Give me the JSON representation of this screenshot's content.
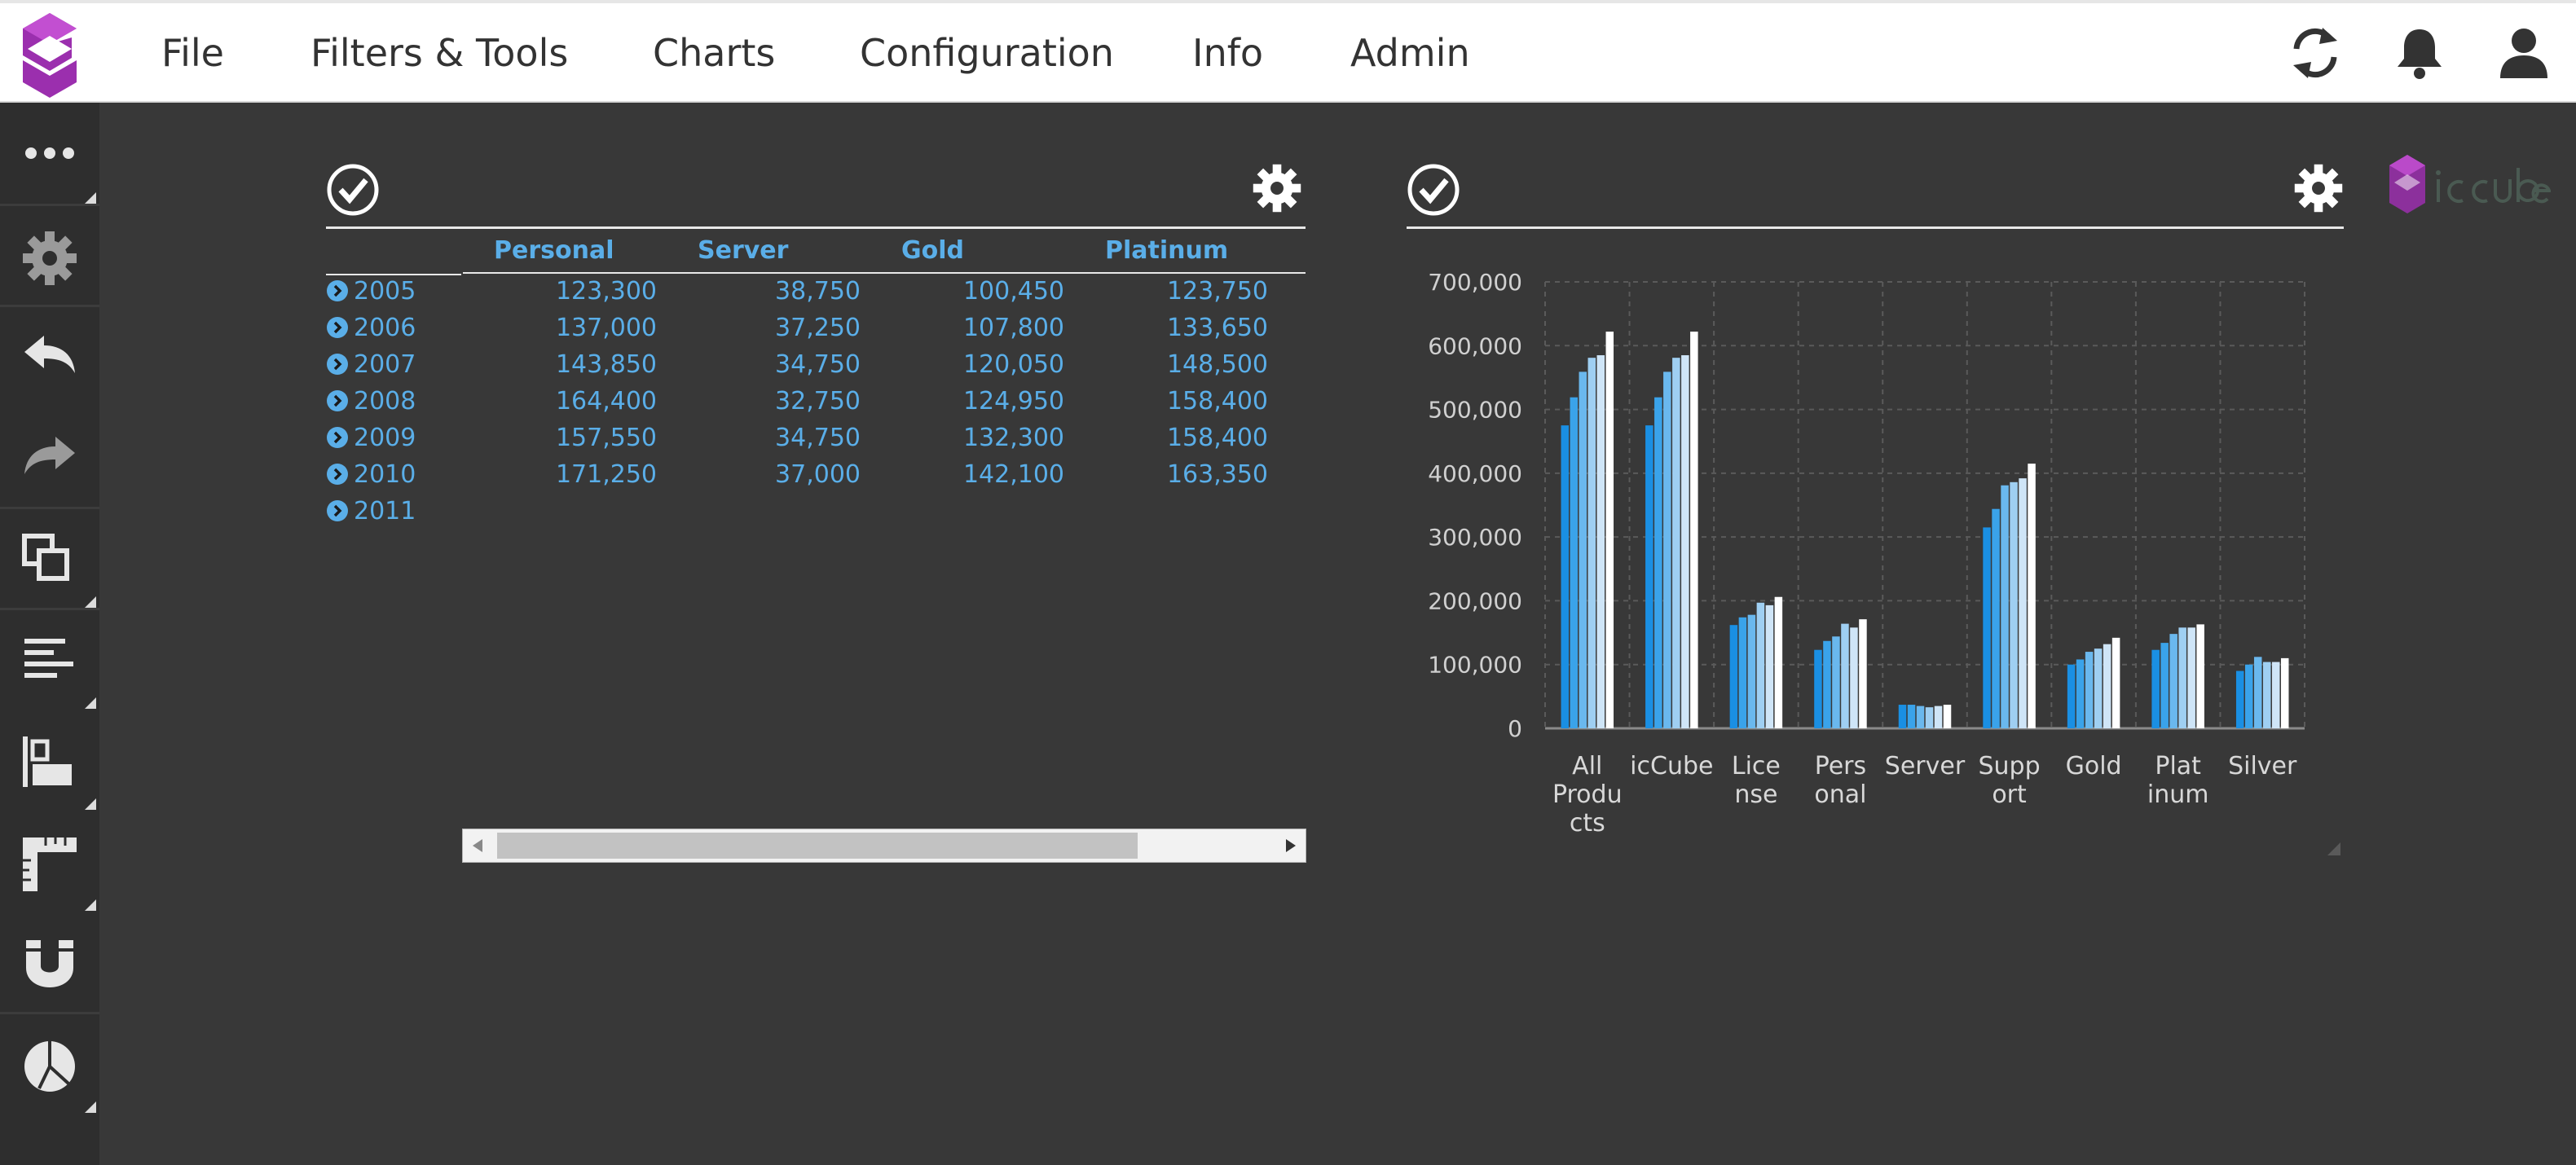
{
  "menu": {
    "file": "File",
    "filters_tools": "Filters & Tools",
    "charts": "Charts",
    "configuration": "Configuration",
    "info": "Info",
    "admin": "Admin"
  },
  "toolbar_icons": [
    "refresh-icon",
    "bell-icon",
    "user-icon"
  ],
  "sidebar_icons": [
    "more-icon",
    "settings-icon",
    "undo-icon",
    "redo-icon",
    "duplicate-icon",
    "align-left-icon",
    "align-top-icon",
    "ruler-icon",
    "magnet-icon",
    "theme-icon"
  ],
  "pivot": {
    "columns": [
      "Personal",
      "Server",
      "Gold",
      "Platinum"
    ],
    "rows": [
      {
        "label": "2005",
        "values": [
          "123,300",
          "38,750",
          "100,450",
          "123,750"
        ]
      },
      {
        "label": "2006",
        "values": [
          "137,000",
          "37,250",
          "107,800",
          "133,650"
        ]
      },
      {
        "label": "2007",
        "values": [
          "143,850",
          "34,750",
          "120,050",
          "148,500"
        ]
      },
      {
        "label": "2008",
        "values": [
          "164,400",
          "32,750",
          "124,950",
          "158,400"
        ]
      },
      {
        "label": "2009",
        "values": [
          "157,550",
          "34,750",
          "132,300",
          "158,400"
        ]
      },
      {
        "label": "2010",
        "values": [
          "171,250",
          "37,000",
          "142,100",
          "163,350"
        ]
      },
      {
        "label": "2011",
        "values": [
          "",
          "",
          "",
          ""
        ]
      }
    ]
  },
  "colors": {
    "background": "#383838",
    "accent": "#5aaee8",
    "logo": "#9b2fae"
  },
  "chart_data": {
    "type": "bar",
    "categories": [
      "All Products",
      "icCube",
      "License",
      "Personal",
      "Server",
      "Support",
      "Gold",
      "Platinum",
      "Silver"
    ],
    "category_lines": [
      [
        "All",
        "Produ",
        "cts"
      ],
      [
        "icCube"
      ],
      [
        "Lice",
        "nse"
      ],
      [
        "Pers",
        "onal"
      ],
      [
        "Server"
      ],
      [
        "Supp",
        "ort"
      ],
      [
        "Gold"
      ],
      [
        "Plat",
        "inum"
      ],
      [
        "Silver"
      ]
    ],
    "series": [
      {
        "color": "#1a8fe3",
        "values": [
          475000,
          475000,
          162000,
          123000,
          37000,
          315000,
          100000,
          123000,
          90000
        ]
      },
      {
        "color": "#3aa3ea",
        "values": [
          519000,
          519000,
          174000,
          137000,
          37000,
          344000,
          108000,
          134000,
          100000
        ]
      },
      {
        "color": "#6ab8ee",
        "values": [
          559000,
          559000,
          178000,
          144000,
          35000,
          381000,
          120000,
          148000,
          112000
        ]
      },
      {
        "color": "#9fcff2",
        "values": [
          581000,
          581000,
          197000,
          164000,
          33000,
          386000,
          125000,
          158000,
          104000
        ]
      },
      {
        "color": "#cfe5f7",
        "values": [
          585000,
          585000,
          193000,
          158000,
          35000,
          392000,
          132000,
          158000,
          104000
        ]
      },
      {
        "color": "#ffffff",
        "values": [
          622000,
          622000,
          206000,
          171000,
          37000,
          415000,
          142000,
          163000,
          110000
        ]
      }
    ],
    "yticks": [
      "0",
      "100,000",
      "200,000",
      "300,000",
      "400,000",
      "500,000",
      "600,000",
      "700,000"
    ],
    "ylim": [
      0,
      700000
    ],
    "xlabel": "",
    "ylabel": "",
    "grid": true
  }
}
